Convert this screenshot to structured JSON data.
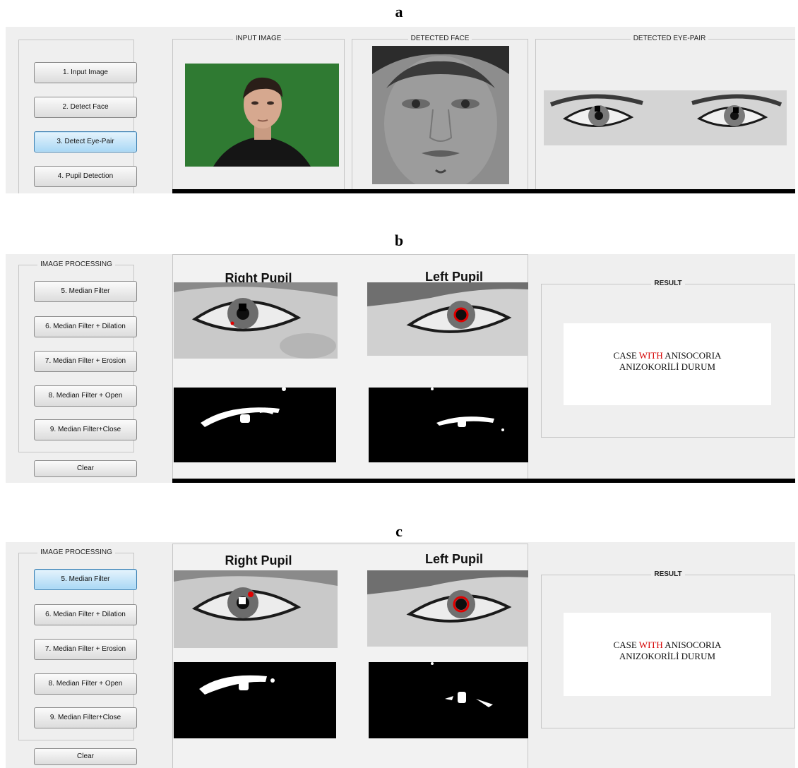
{
  "panels": [
    {
      "label": "a",
      "sidebar": {
        "title": "",
        "buttons": [
          "1. Input Image",
          "2. Detect Face",
          "3. Detect Eye-Pair",
          "4. Pupil Detection"
        ],
        "active_index": 2
      },
      "groups": [
        "INPUT IMAGE",
        "DETECTED FACE",
        "DETECTED EYE-PAIR"
      ]
    },
    {
      "label": "b",
      "sidebar": {
        "title": "IMAGE PROCESSING",
        "buttons": [
          "5. Median Filter",
          "6. Median Filter + Dilation",
          "7. Median Filter + Erosion",
          "8. Median Filter + Open",
          "9. Median Filter+Close"
        ],
        "clear": "Clear"
      },
      "pupils": {
        "right": "Right Pupil",
        "left": "Left Pupil"
      },
      "result": {
        "title": "RESULT",
        "line1_pre": "CASE ",
        "line1_red": "WITH",
        "line1_post": " ANISOCORIA",
        "line2": "ANIZOKORİLİ DURUM"
      }
    },
    {
      "label": "c",
      "sidebar": {
        "title": "IMAGE PROCESSING",
        "buttons": [
          "5. Median Filter",
          "6. Median Filter + Dilation",
          "7. Median Filter + Erosion",
          "8. Median Filter + Open",
          "9. Median Filter+Close"
        ],
        "clear": "Clear",
        "active_index": 0
      },
      "pupils": {
        "right": "Right Pupil",
        "left": "Left Pupil"
      },
      "result": {
        "title": "RESULT",
        "line1_pre": "CASE ",
        "line1_red": "WITH",
        "line1_post": " ANISOCORIA",
        "line2": "ANIZOKORİLİ DURUM"
      }
    }
  ],
  "colors": {
    "active_button": "#a9d8f5",
    "result_highlight": "#d40000",
    "background_green": "#2f7a32"
  }
}
